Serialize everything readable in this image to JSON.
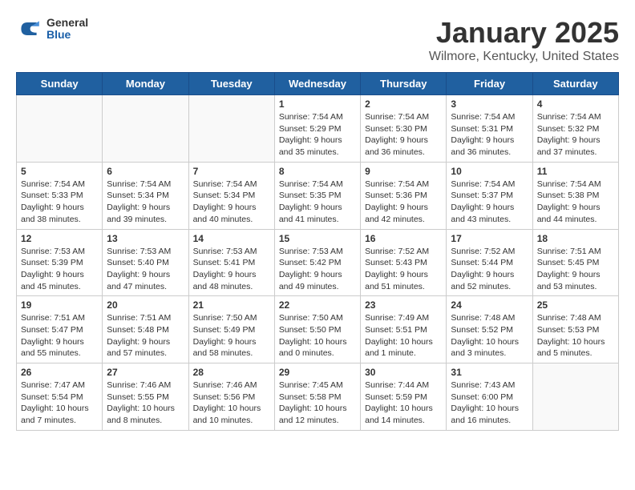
{
  "header": {
    "logo_general": "General",
    "logo_blue": "Blue",
    "month": "January 2025",
    "location": "Wilmore, Kentucky, United States"
  },
  "days_of_week": [
    "Sunday",
    "Monday",
    "Tuesday",
    "Wednesday",
    "Thursday",
    "Friday",
    "Saturday"
  ],
  "weeks": [
    [
      {
        "day": "",
        "info": ""
      },
      {
        "day": "",
        "info": ""
      },
      {
        "day": "",
        "info": ""
      },
      {
        "day": "1",
        "info": "Sunrise: 7:54 AM\nSunset: 5:29 PM\nDaylight: 9 hours\nand 35 minutes."
      },
      {
        "day": "2",
        "info": "Sunrise: 7:54 AM\nSunset: 5:30 PM\nDaylight: 9 hours\nand 36 minutes."
      },
      {
        "day": "3",
        "info": "Sunrise: 7:54 AM\nSunset: 5:31 PM\nDaylight: 9 hours\nand 36 minutes."
      },
      {
        "day": "4",
        "info": "Sunrise: 7:54 AM\nSunset: 5:32 PM\nDaylight: 9 hours\nand 37 minutes."
      }
    ],
    [
      {
        "day": "5",
        "info": "Sunrise: 7:54 AM\nSunset: 5:33 PM\nDaylight: 9 hours\nand 38 minutes."
      },
      {
        "day": "6",
        "info": "Sunrise: 7:54 AM\nSunset: 5:34 PM\nDaylight: 9 hours\nand 39 minutes."
      },
      {
        "day": "7",
        "info": "Sunrise: 7:54 AM\nSunset: 5:34 PM\nDaylight: 9 hours\nand 40 minutes."
      },
      {
        "day": "8",
        "info": "Sunrise: 7:54 AM\nSunset: 5:35 PM\nDaylight: 9 hours\nand 41 minutes."
      },
      {
        "day": "9",
        "info": "Sunrise: 7:54 AM\nSunset: 5:36 PM\nDaylight: 9 hours\nand 42 minutes."
      },
      {
        "day": "10",
        "info": "Sunrise: 7:54 AM\nSunset: 5:37 PM\nDaylight: 9 hours\nand 43 minutes."
      },
      {
        "day": "11",
        "info": "Sunrise: 7:54 AM\nSunset: 5:38 PM\nDaylight: 9 hours\nand 44 minutes."
      }
    ],
    [
      {
        "day": "12",
        "info": "Sunrise: 7:53 AM\nSunset: 5:39 PM\nDaylight: 9 hours\nand 45 minutes."
      },
      {
        "day": "13",
        "info": "Sunrise: 7:53 AM\nSunset: 5:40 PM\nDaylight: 9 hours\nand 47 minutes."
      },
      {
        "day": "14",
        "info": "Sunrise: 7:53 AM\nSunset: 5:41 PM\nDaylight: 9 hours\nand 48 minutes."
      },
      {
        "day": "15",
        "info": "Sunrise: 7:53 AM\nSunset: 5:42 PM\nDaylight: 9 hours\nand 49 minutes."
      },
      {
        "day": "16",
        "info": "Sunrise: 7:52 AM\nSunset: 5:43 PM\nDaylight: 9 hours\nand 51 minutes."
      },
      {
        "day": "17",
        "info": "Sunrise: 7:52 AM\nSunset: 5:44 PM\nDaylight: 9 hours\nand 52 minutes."
      },
      {
        "day": "18",
        "info": "Sunrise: 7:51 AM\nSunset: 5:45 PM\nDaylight: 9 hours\nand 53 minutes."
      }
    ],
    [
      {
        "day": "19",
        "info": "Sunrise: 7:51 AM\nSunset: 5:47 PM\nDaylight: 9 hours\nand 55 minutes."
      },
      {
        "day": "20",
        "info": "Sunrise: 7:51 AM\nSunset: 5:48 PM\nDaylight: 9 hours\nand 57 minutes."
      },
      {
        "day": "21",
        "info": "Sunrise: 7:50 AM\nSunset: 5:49 PM\nDaylight: 9 hours\nand 58 minutes."
      },
      {
        "day": "22",
        "info": "Sunrise: 7:50 AM\nSunset: 5:50 PM\nDaylight: 10 hours\nand 0 minutes."
      },
      {
        "day": "23",
        "info": "Sunrise: 7:49 AM\nSunset: 5:51 PM\nDaylight: 10 hours\nand 1 minute."
      },
      {
        "day": "24",
        "info": "Sunrise: 7:48 AM\nSunset: 5:52 PM\nDaylight: 10 hours\nand 3 minutes."
      },
      {
        "day": "25",
        "info": "Sunrise: 7:48 AM\nSunset: 5:53 PM\nDaylight: 10 hours\nand 5 minutes."
      }
    ],
    [
      {
        "day": "26",
        "info": "Sunrise: 7:47 AM\nSunset: 5:54 PM\nDaylight: 10 hours\nand 7 minutes."
      },
      {
        "day": "27",
        "info": "Sunrise: 7:46 AM\nSunset: 5:55 PM\nDaylight: 10 hours\nand 8 minutes."
      },
      {
        "day": "28",
        "info": "Sunrise: 7:46 AM\nSunset: 5:56 PM\nDaylight: 10 hours\nand 10 minutes."
      },
      {
        "day": "29",
        "info": "Sunrise: 7:45 AM\nSunset: 5:58 PM\nDaylight: 10 hours\nand 12 minutes."
      },
      {
        "day": "30",
        "info": "Sunrise: 7:44 AM\nSunset: 5:59 PM\nDaylight: 10 hours\nand 14 minutes."
      },
      {
        "day": "31",
        "info": "Sunrise: 7:43 AM\nSunset: 6:00 PM\nDaylight: 10 hours\nand 16 minutes."
      },
      {
        "day": "",
        "info": ""
      }
    ]
  ]
}
